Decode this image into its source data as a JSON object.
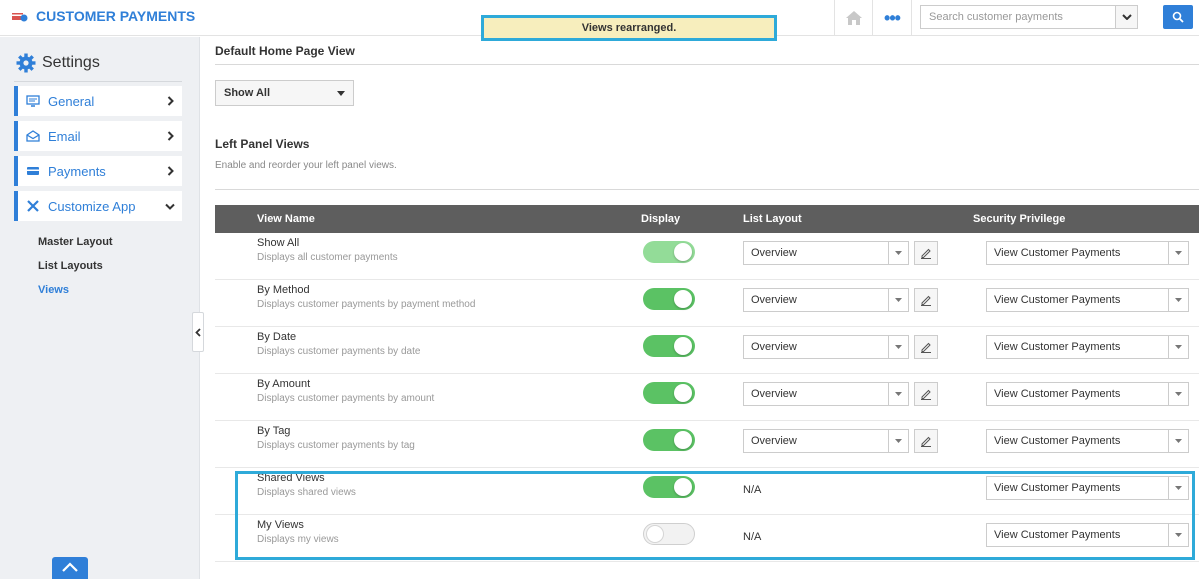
{
  "app": {
    "title": "CUSTOMER PAYMENTS",
    "accent_color": "#2f7fd8"
  },
  "toast": {
    "message": "Views rearranged."
  },
  "header": {
    "home_icon": "home-icon",
    "more_icon": "ellipsis-icon",
    "more_label": "•••",
    "search": {
      "placeholder": "Search customer payments",
      "value": ""
    }
  },
  "sidebar": {
    "heading": "Settings",
    "items": [
      {
        "label": "General",
        "icon": "monitor-icon",
        "expanded": false
      },
      {
        "label": "Email",
        "icon": "envelope-icon",
        "expanded": false
      },
      {
        "label": "Payments",
        "icon": "card-icon",
        "expanded": false
      },
      {
        "label": "Customize App",
        "icon": "tools-icon",
        "expanded": true
      }
    ],
    "sub_items": [
      {
        "label": "Master Layout",
        "active": false
      },
      {
        "label": "List Layouts",
        "active": false
      },
      {
        "label": "Views",
        "active": true
      }
    ]
  },
  "main": {
    "default_view": {
      "title": "Default Home Page View",
      "selected": "Show All"
    },
    "left_panel": {
      "title": "Left Panel Views",
      "description": "Enable and reorder your left panel views."
    },
    "table": {
      "columns": [
        "View Name",
        "Display",
        "List Layout",
        "Security Privilege"
      ],
      "rows": [
        {
          "name": "Show All",
          "desc": "Displays all customer payments",
          "display": "on-locked",
          "layout": "Overview",
          "privilege": "View Customer Payments"
        },
        {
          "name": "By Method",
          "desc": "Displays customer payments by payment method",
          "display": "on",
          "layout": "Overview",
          "privilege": "View Customer Payments"
        },
        {
          "name": "By Date",
          "desc": "Displays customer payments by date",
          "display": "on",
          "layout": "Overview",
          "privilege": "View Customer Payments"
        },
        {
          "name": "By Amount",
          "desc": "Displays customer payments by amount",
          "display": "on",
          "layout": "Overview",
          "privilege": "View Customer Payments"
        },
        {
          "name": "By Tag",
          "desc": "Displays customer payments by tag",
          "display": "on",
          "layout": "Overview",
          "privilege": "View Customer Payments"
        },
        {
          "name": "Shared Views",
          "desc": "Displays shared views",
          "display": "on",
          "layout": "N/A",
          "privilege": "View Customer Payments"
        },
        {
          "name": "My Views",
          "desc": "Displays my views",
          "display": "off",
          "layout": "N/A",
          "privilege": "View Customer Payments"
        }
      ]
    }
  }
}
